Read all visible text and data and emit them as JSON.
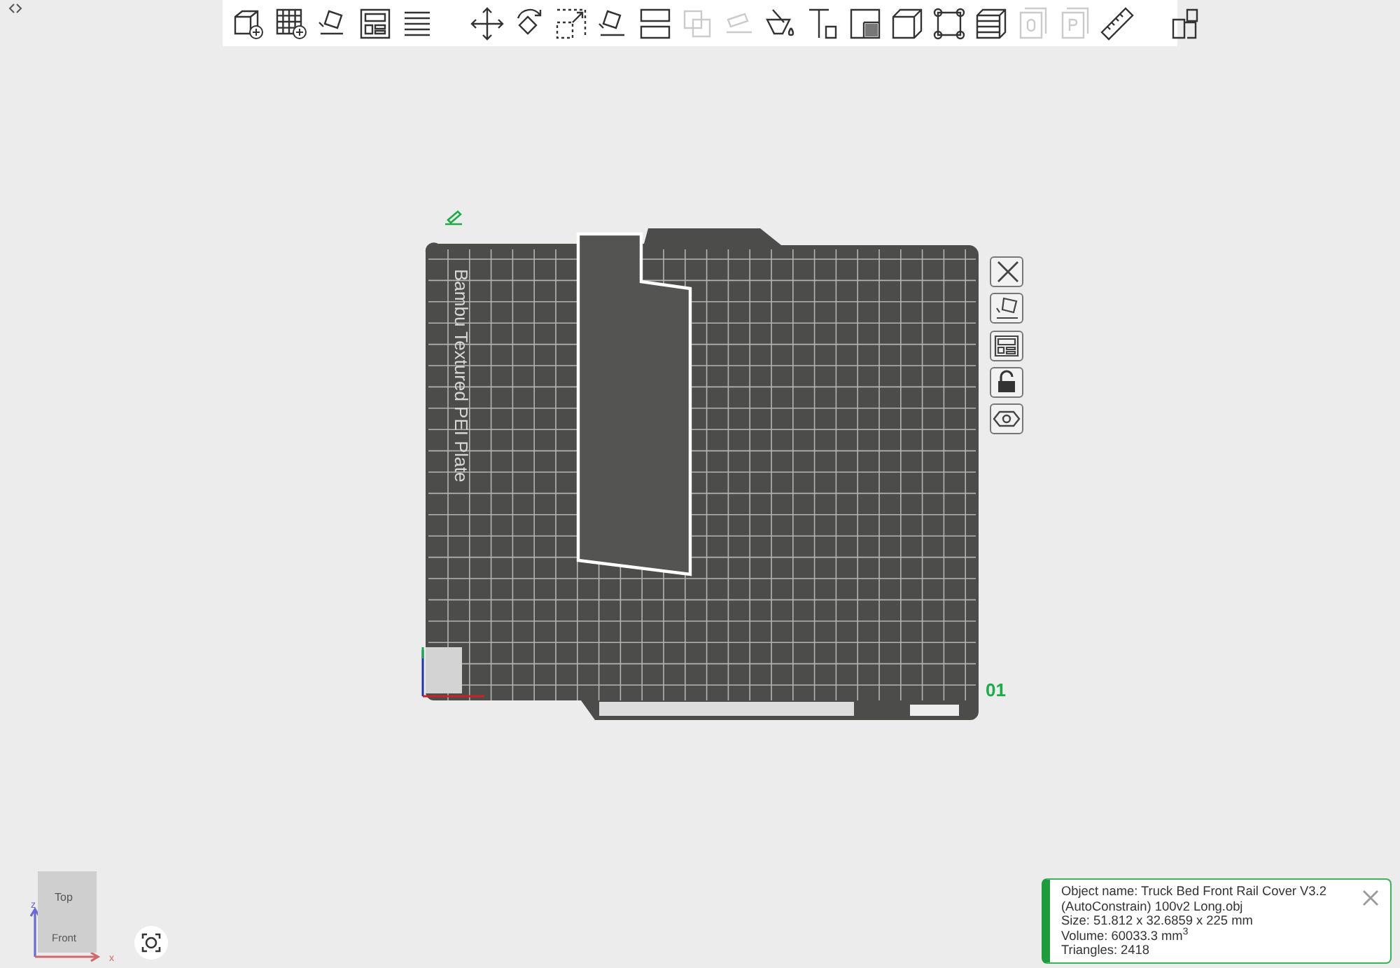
{
  "toolbar": {
    "groups": [
      [
        {
          "disabled": false
        },
        {
          "disabled": false
        },
        {
          "disabled": false
        },
        {
          "disabled": false
        },
        {
          "disabled": false
        }
      ],
      [
        {
          "disabled": false
        },
        {
          "disabled": false
        },
        {
          "disabled": false
        },
        {
          "disabled": false
        },
        {
          "disabled": false
        },
        {
          "disabled": true
        },
        {
          "disabled": true
        },
        {
          "disabled": false
        },
        {
          "disabled": false
        },
        {
          "disabled": false
        },
        {
          "disabled": false
        },
        {
          "disabled": false
        },
        {
          "disabled": false
        },
        {
          "disabled": true
        },
        {
          "disabled": true
        },
        {
          "disabled": false
        }
      ],
      [
        {
          "disabled": false
        }
      ]
    ]
  },
  "plate": {
    "label": "Bambu Textured PEI Plate",
    "number": "01",
    "object": {
      "selected": true
    }
  },
  "view_cube": {
    "faces": [
      "Top",
      "Front"
    ],
    "axes": [
      "z",
      "x"
    ]
  },
  "info_panel": {
    "lines": [
      "Object name: Truck Bed Front Rail Cover V3.2",
      "(AutoConstrain) 100v2 Long.obj",
      "Size: 51.812 x 32.6859 x 225 mm",
      "Volume: 60033.3 mm$^{3}$",
      "Triangles: 2418"
    ]
  }
}
